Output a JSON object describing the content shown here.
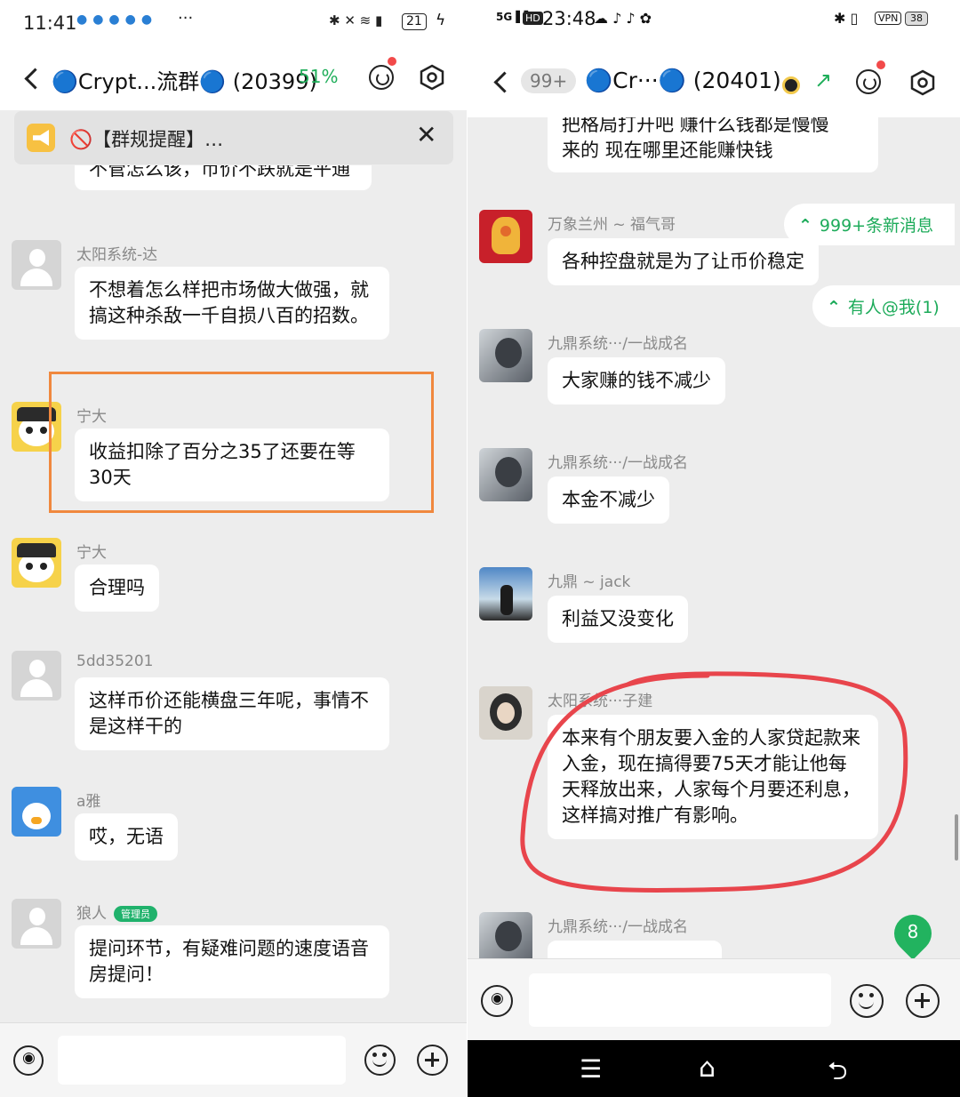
{
  "left": {
    "status": {
      "time": "11:41",
      "battery": "21"
    },
    "header": {
      "title": "🔵Crypt...流群🔵 (20399)",
      "percent": "51%"
    },
    "notice": {
      "text": "🚫【群规提醒】…"
    },
    "top_partial": "不管怎么该，币价不跌就是平通",
    "messages": [
      {
        "name": "太阳系统-达",
        "text": "不想着怎么样把市场做大做强，就搞这种杀敌一千自损八百的招数。"
      },
      {
        "name": "宁大",
        "text": "收益扣除了百分之35了还要在等30天"
      },
      {
        "name": "宁大",
        "text": "合理吗"
      },
      {
        "name": "5dd35201",
        "text": "这样币价还能横盘三年呢，事情不是这样干的"
      },
      {
        "name": "a雅",
        "text": "哎，无语"
      },
      {
        "name": "狼人",
        "badge": "管理员",
        "text": "提问环节，有疑难问题的速度语音房提问！"
      }
    ]
  },
  "right": {
    "status": {
      "time": "23:48",
      "battery": "38",
      "vpn": "VPN"
    },
    "header": {
      "unread": "99+",
      "title": "🔵Cr···🔵 (20401)"
    },
    "top_partial_1": "把格局打开吧 赚什么钱都是慢慢",
    "top_partial_2": "来的 现在哪里还能赚快钱",
    "float_new": "999+条新消息",
    "float_at": "有人@我(1)",
    "messages": [
      {
        "name": "万象兰州 ~ 福气哥",
        "text": "各种控盘就是为了让币价稳定"
      },
      {
        "name": "九鼎系统···/一战成名",
        "text": "大家赚的钱不减少"
      },
      {
        "name": "九鼎系统···/一战成名",
        "text": "本金不减少"
      },
      {
        "name": "九鼎 ~ jack",
        "text": "利益又没变化"
      },
      {
        "name": "太阳系统···子建",
        "text": "本来有个朋友要入金的人家贷起款来入金，现在搞得要75天才能让他每天释放出来，人家每个月要还利息，这样搞对推广有影响。"
      },
      {
        "name": "九鼎系统···/一战成名",
        "text": ""
      }
    ],
    "unread_count": "8"
  }
}
